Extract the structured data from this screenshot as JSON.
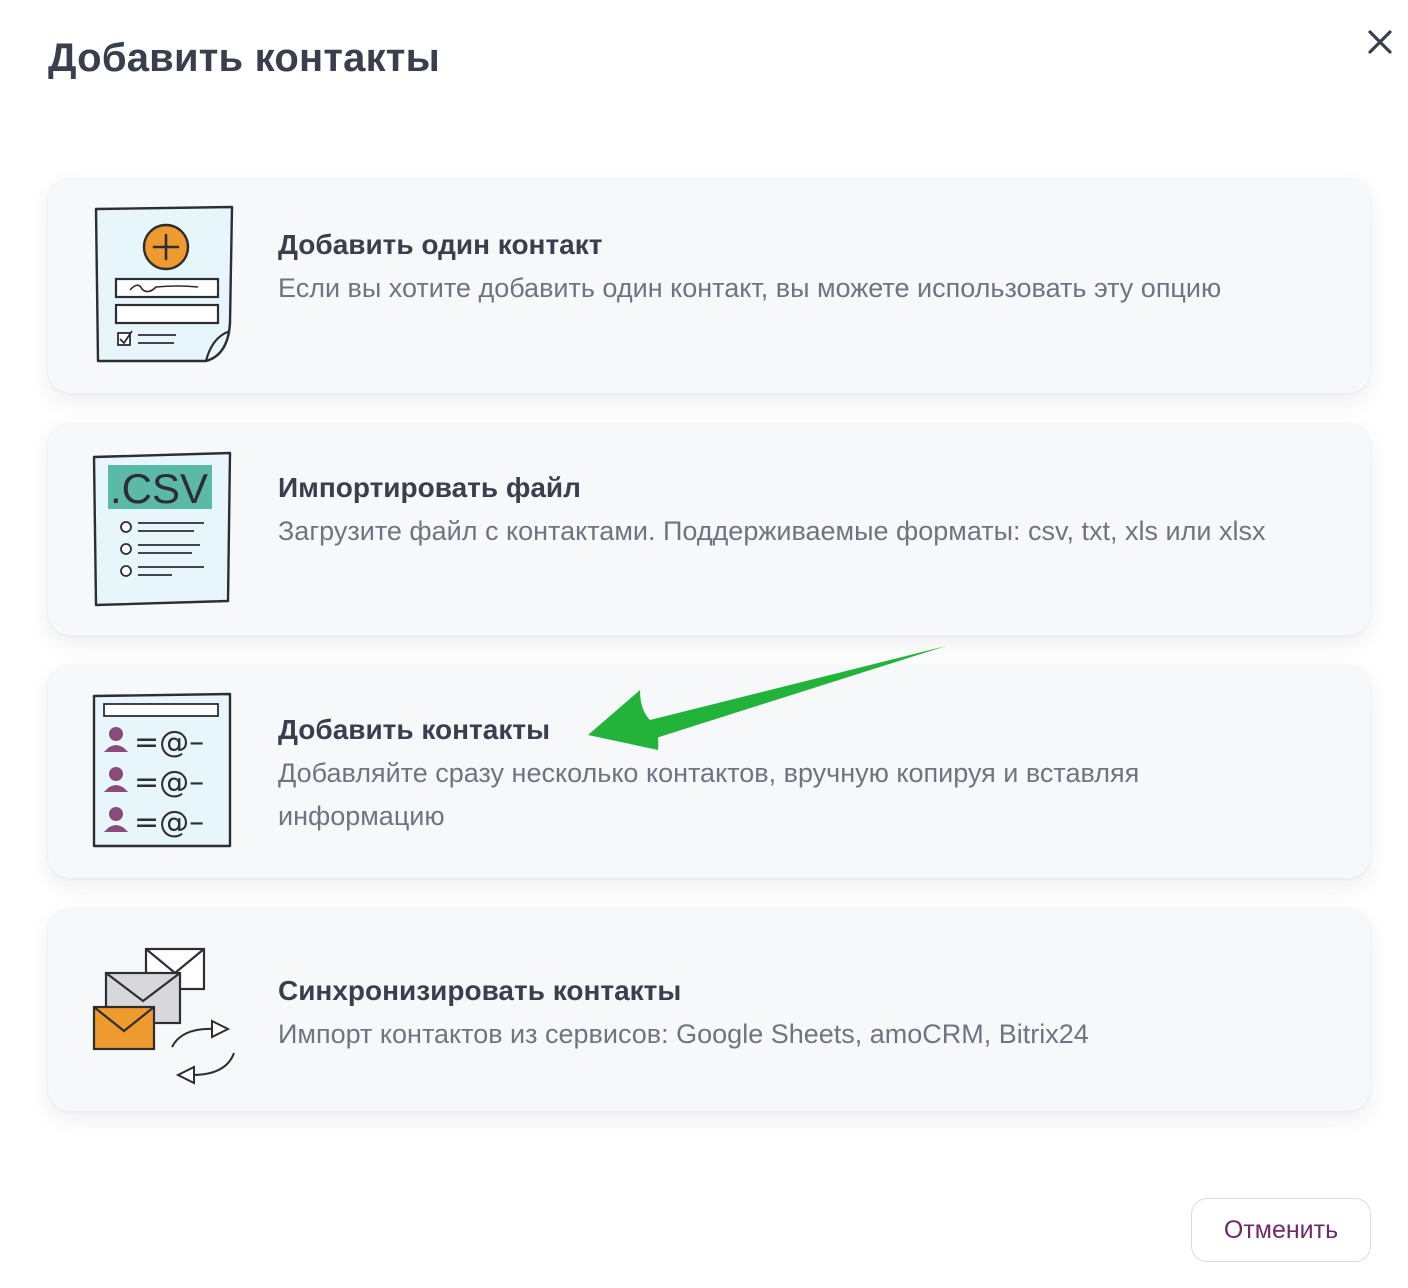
{
  "modal": {
    "title": "Добавить контакты",
    "close_icon": "close-icon"
  },
  "options": [
    {
      "title": "Добавить один контакт",
      "description": "Если вы хотите добавить один контакт, вы можете использовать эту опцию",
      "icon": "add-contact-form-icon"
    },
    {
      "title": "Импортировать файл",
      "description": "Загрузите файл с контактами. Поддерживаемые форматы: csv, txt, xls или xlsx",
      "icon": "csv-file-icon",
      "icon_label": ".CSV"
    },
    {
      "title": "Добавить контакты",
      "description": "Добавляйте сразу несколько контактов, вручную копируя и вставляя информацию",
      "icon": "contact-list-icon",
      "icon_rows": [
        "=@–",
        "=@–",
        "=@–"
      ]
    },
    {
      "title": "Синхронизировать контакты",
      "description": "Импорт контактов из сервисов: Google Sheets, amoCRM, Bitrix24",
      "icon": "sync-envelopes-icon"
    }
  ],
  "footer": {
    "cancel_label": "Отменить"
  },
  "annotation": {
    "icon": "green-arrow-icon",
    "color": "#22b33a"
  },
  "colors": {
    "title": "#3a3f4d",
    "description": "#6f7482",
    "cancel_text": "#6c2a6a",
    "card_bg": "#f7f8fa",
    "accent_orange": "#ef9a2e",
    "accent_teal": "#5bbaa7",
    "accent_purple": "#8a4a7a"
  }
}
